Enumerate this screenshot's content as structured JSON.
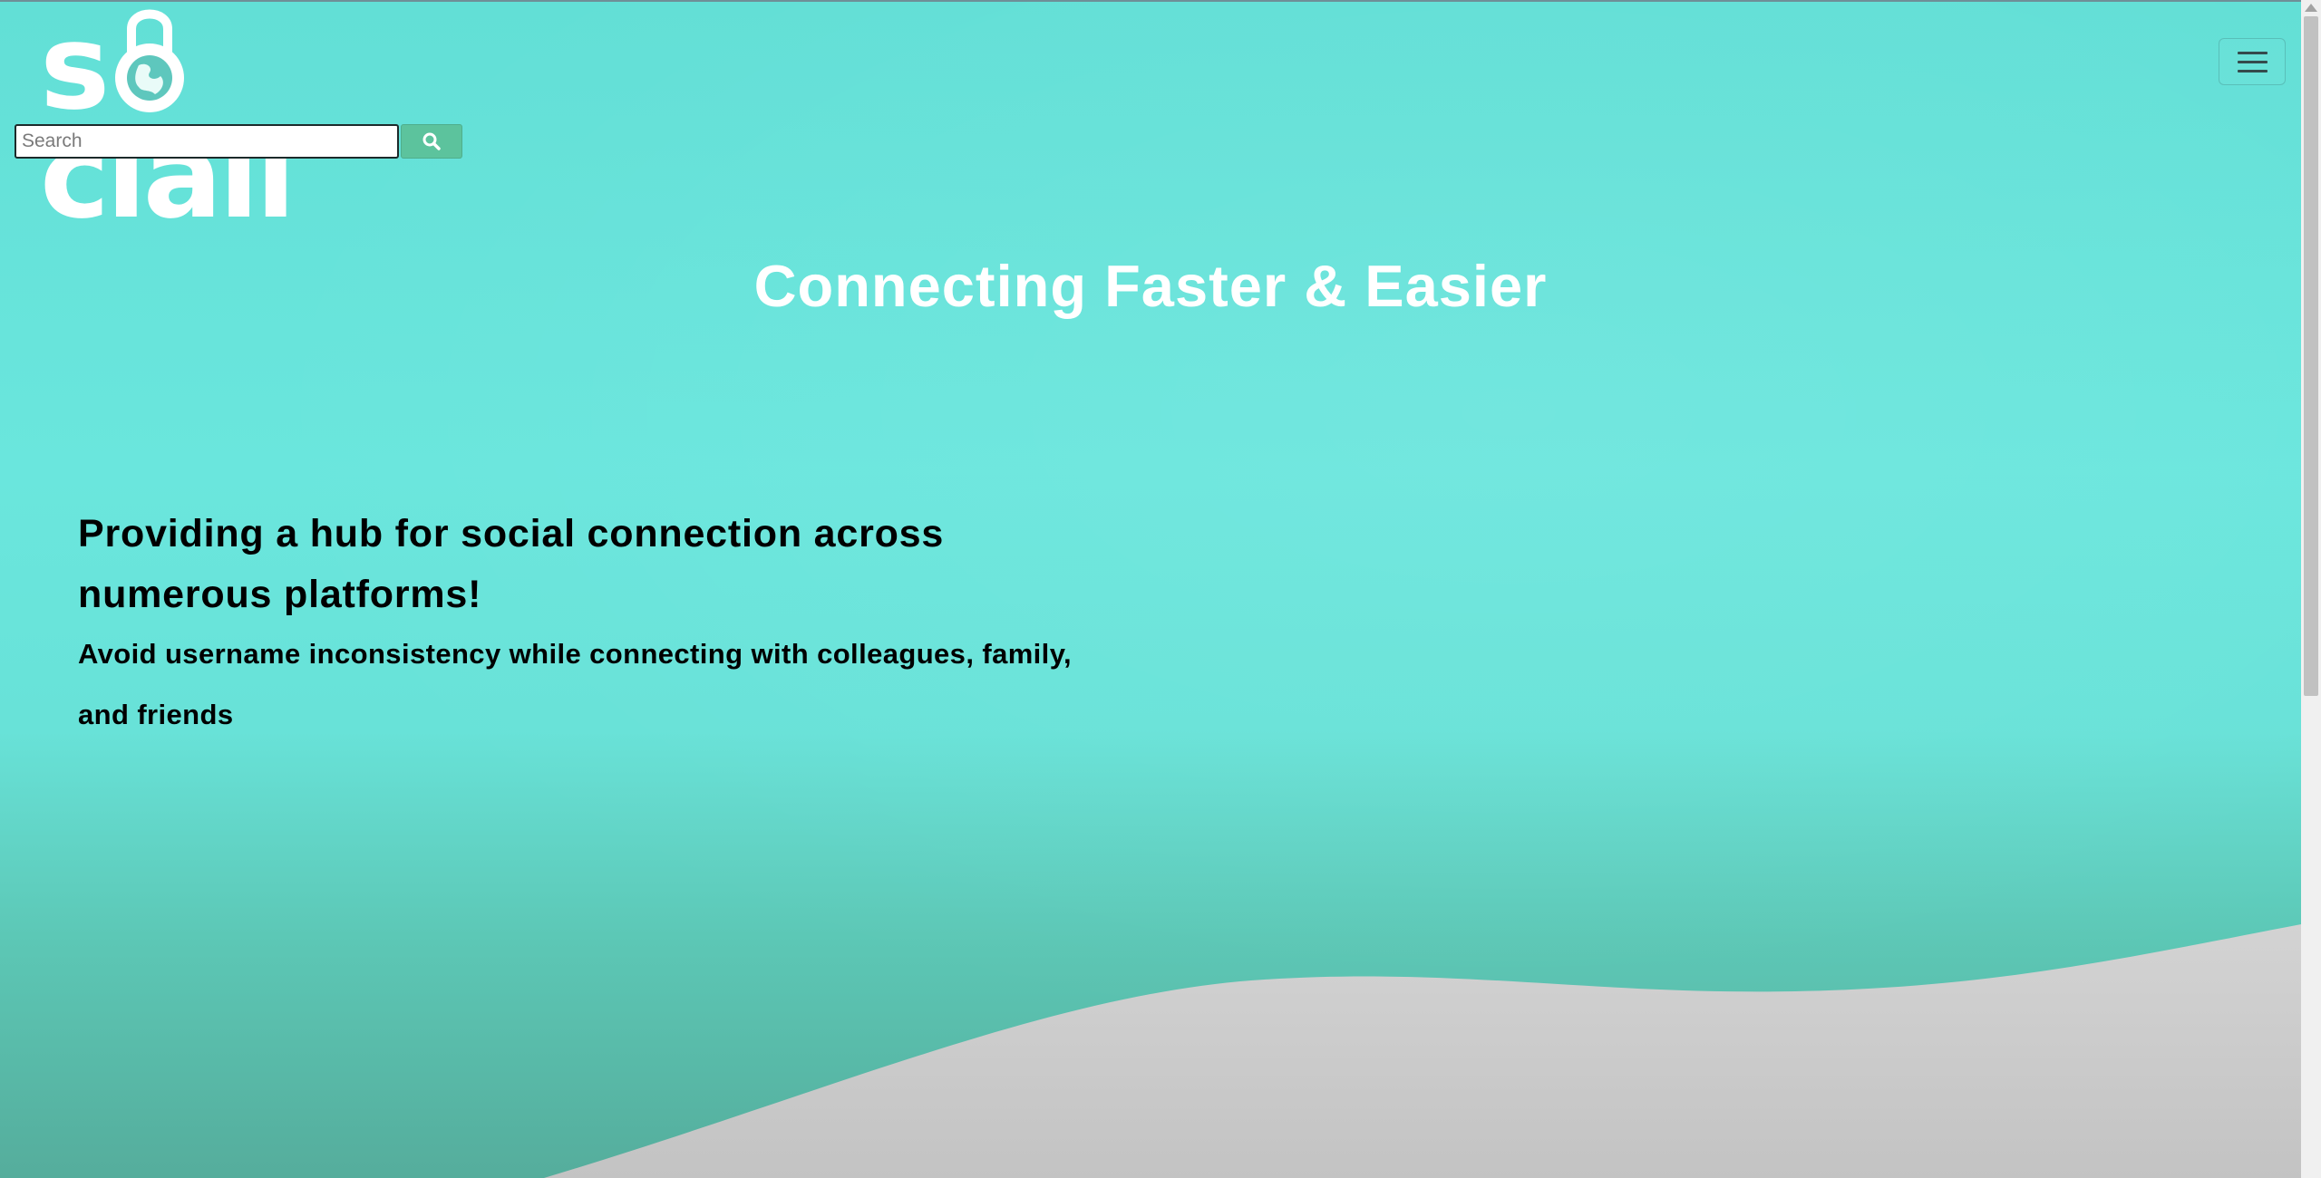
{
  "colors": {
    "background_teal": "#66e3da",
    "background_bottom": "#55ad9c",
    "wave_gray": "#cccccc",
    "search_button": "#5cc39d",
    "hero_title": "#ffffff",
    "body_text": "#000000"
  },
  "header": {
    "logo_text": "sociall",
    "logo_icon": "padlock-globe-icon",
    "search": {
      "placeholder": "Search",
      "value": "",
      "button_icon": "search-icon"
    },
    "menu_icon": "hamburger-menu-icon"
  },
  "hero": {
    "title": "Connecting Faster & Easier",
    "tagline": "Providing a hub for social connection across numerous platforms!",
    "subtagline": "Avoid username inconsistency while connecting with colleagues, family, and friends"
  }
}
